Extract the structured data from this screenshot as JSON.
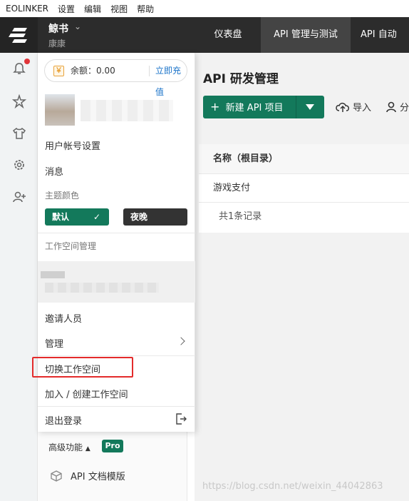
{
  "menubar": {
    "items": [
      "EOLINKER",
      "设置",
      "编辑",
      "视图",
      "帮助"
    ]
  },
  "header": {
    "workspace": "鲸书",
    "user": "康康",
    "tabs": [
      "仪表盘",
      "API 管理与测试",
      "API 自动"
    ]
  },
  "dropdown": {
    "balance_label": "余额：0.00",
    "balance_coin": "￥",
    "recharge": "立即充值",
    "items": {
      "account": "用户帐号设置",
      "messages": "消息",
      "theme_label": "主题颜色",
      "theme_default": "默认",
      "theme_night": "夜晚",
      "workspace_manage": "工作空间管理",
      "invite": "邀请人员",
      "manage": "管理",
      "switch": "切换工作空间",
      "join": "加入 / 创建工作空间",
      "logout": "退出登录"
    }
  },
  "subnav": {
    "advanced": "高级功能",
    "pro": "Pro",
    "api_doc": "API 文档模版"
  },
  "main": {
    "title": "API 研发管理",
    "new_project": "新建 API 项目",
    "import": "导入",
    "share": "分",
    "table": {
      "header": "名称（根目录）",
      "rows": [
        "游戏支付"
      ],
      "footer": "共1条记录"
    }
  },
  "watermark": "https://blog.csdn.net/weixin_44042863",
  "colors": {
    "accent": "#13795b",
    "header": "#2c2c2c",
    "highlight": "#e32b2b"
  }
}
